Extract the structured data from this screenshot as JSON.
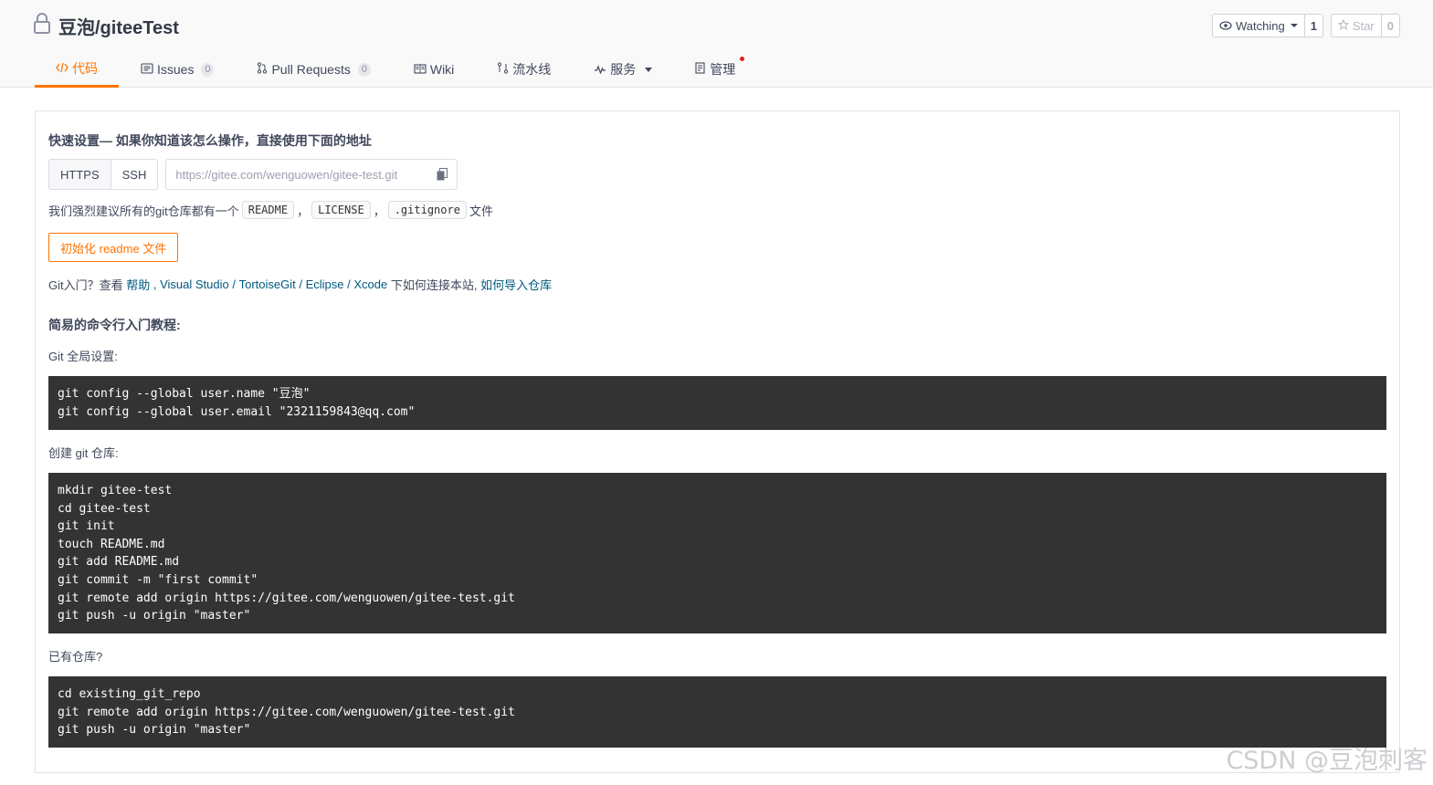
{
  "repo": {
    "title": "豆泡/giteeTest"
  },
  "actions": {
    "watch_label": "Watching",
    "watch_count": "1",
    "star_label": "Star",
    "star_count": "0"
  },
  "tabs": [
    {
      "label": "代码",
      "icon": "code-icon",
      "active": true
    },
    {
      "label": "Issues",
      "icon": "issues-icon",
      "badge": "0"
    },
    {
      "label": "Pull Requests",
      "icon": "pull-request-icon",
      "badge": "0"
    },
    {
      "label": "Wiki",
      "icon": "wiki-icon"
    },
    {
      "label": "流水线",
      "icon": "pipeline-icon"
    },
    {
      "label": "服务",
      "icon": "service-icon",
      "dropdown": true
    },
    {
      "label": "管理",
      "icon": "manage-icon",
      "notification_dot": true
    }
  ],
  "quick_setup": {
    "title": "快速设置— 如果你知道该怎么操作，直接使用下面的地址",
    "https_label": "HTTPS",
    "ssh_label": "SSH",
    "url": "https://gitee.com/wenguowen/gitee-test.git",
    "recommend_prefix": "我们强烈建议所有的git仓库都有一个",
    "readme_tag": "README",
    "sep1": "，",
    "license_tag": "LICENSE",
    "sep2": "，",
    "gitignore_tag": ".gitignore",
    "recommend_suffix": "文件",
    "init_button": "初始化 readme 文件",
    "help_prefix": "Git入门？查看 ",
    "help_link": "帮助",
    "help_sep1": " , ",
    "vs_link": "Visual Studio",
    "help_sep2": " / ",
    "tortoise_link": "TortoiseGit",
    "help_sep3": " / ",
    "eclipse_link": "Eclipse",
    "help_sep4": " / ",
    "xcode_link": "Xcode",
    "help_middle": " 下如何连接本站, ",
    "import_link": "如何导入仓库"
  },
  "tutorial": {
    "title": "简易的命令行入门教程:",
    "global_label": "Git 全局设置:",
    "global_code": "git config --global user.name \"豆泡\"\ngit config --global user.email \"2321159843@qq.com\"",
    "create_label": "创建 git 仓库:",
    "create_code": "mkdir gitee-test\ncd gitee-test\ngit init\ntouch README.md\ngit add README.md\ngit commit -m \"first commit\"\ngit remote add origin https://gitee.com/wenguowen/gitee-test.git\ngit push -u origin \"master\"",
    "existing_label": "已有仓库?",
    "existing_code": "cd existing_git_repo\ngit remote add origin https://gitee.com/wenguowen/gitee-test.git\ngit push -u origin \"master\""
  },
  "watermark": "CSDN @豆泡刺客",
  "colors": {
    "accent": "#fe7300",
    "link": "#005980",
    "code_bg": "#333333"
  }
}
